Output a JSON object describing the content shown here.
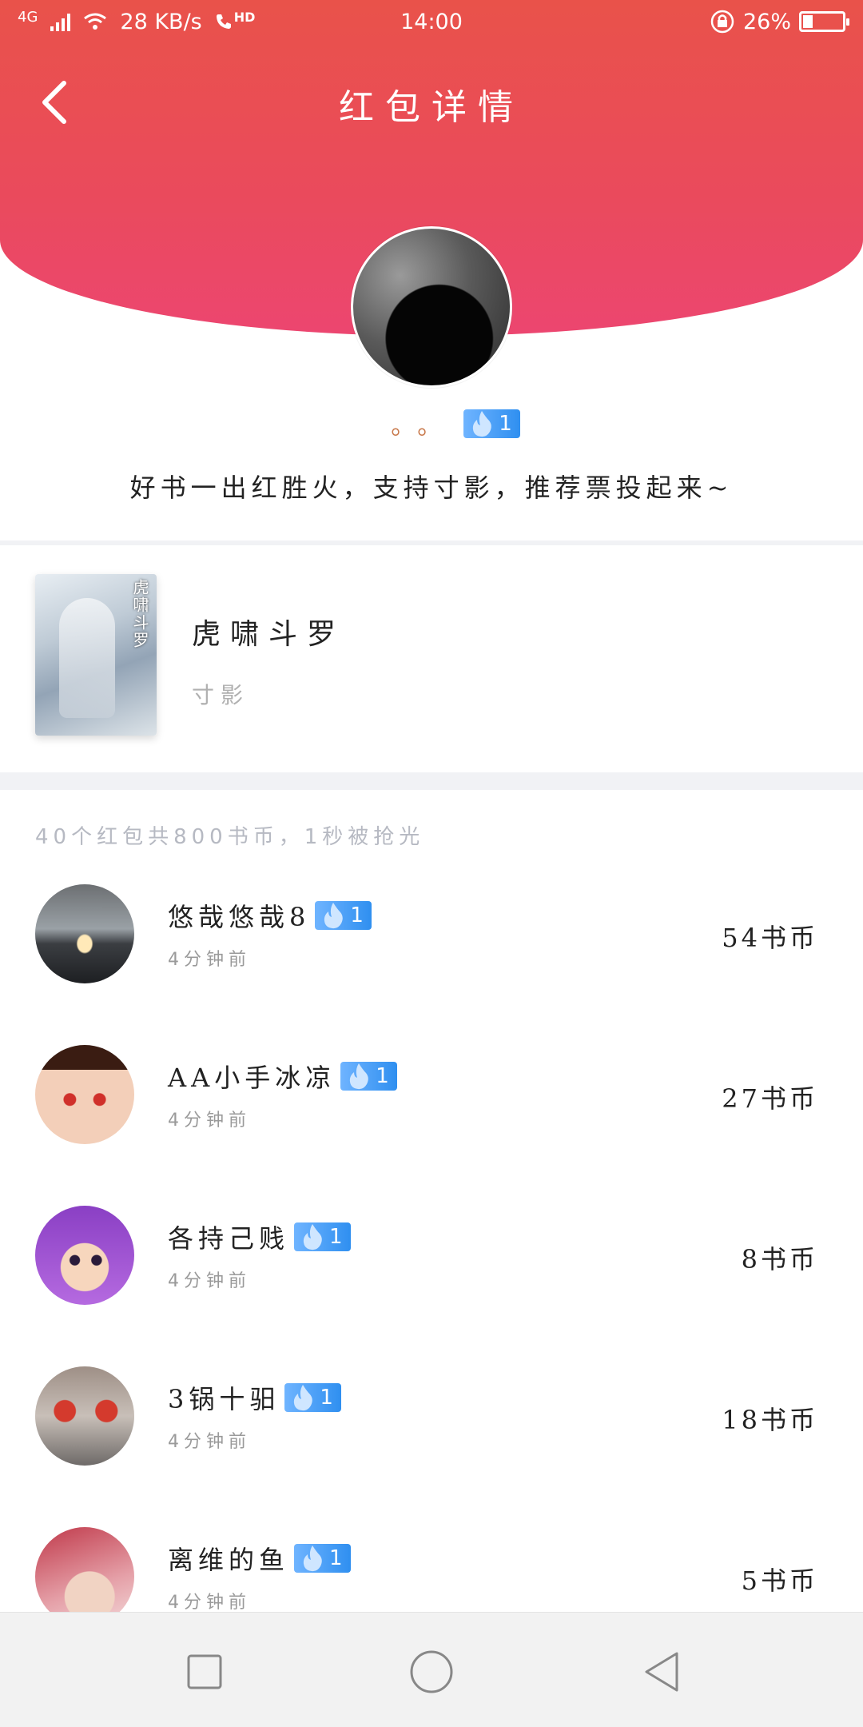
{
  "status_bar": {
    "network": "4G",
    "speed": "28 KB/s",
    "hd": "HD",
    "time": "14:00",
    "battery": "26%"
  },
  "header": {
    "title": "红包详情"
  },
  "sender": {
    "name": "。。",
    "badge_level": "1",
    "message": "好书一出红胜火，支持寸影，推荐票投起来~"
  },
  "book": {
    "cover_title": "虎啸斗罗",
    "title": "虎啸斗罗",
    "author": "寸影"
  },
  "summary": "40个红包共800书币，1秒被抢光",
  "records": [
    {
      "name": "悠哉悠哉8",
      "badge": "1",
      "time": "4分钟前",
      "amount": "54书币"
    },
    {
      "name": "AA小手冰凉",
      "badge": "1",
      "time": "4分钟前",
      "amount": "27书币"
    },
    {
      "name": "各持己贱",
      "badge": "1",
      "time": "4分钟前",
      "amount": "8书币"
    },
    {
      "name": "3锅十驲",
      "badge": "1",
      "time": "4分钟前",
      "amount": "18书币"
    },
    {
      "name": "离维的鱼",
      "badge": "1",
      "time": "4分钟前",
      "amount": "5书币"
    }
  ],
  "colors": {
    "header_top": "#e9524a",
    "header_bottom": "#ec4670",
    "badge": "#2f8ff0"
  },
  "icons": {
    "back": "chevron-left-icon",
    "badge": "flame-icon",
    "nav": [
      "square-icon",
      "circle-icon",
      "triangle-back-icon"
    ]
  }
}
